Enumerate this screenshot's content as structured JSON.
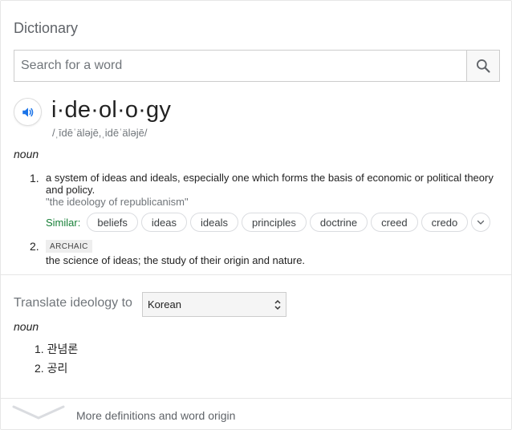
{
  "panel": {
    "title": "Dictionary"
  },
  "search": {
    "placeholder": "Search for a word",
    "value": "",
    "button_icon": "search-icon"
  },
  "entry": {
    "audio_icon": "speaker-icon",
    "headword": "i·de·ol·o·gy",
    "phonetic": "/ˌīdēˈäləjē,ˌidēˈäləjē/",
    "part_of_speech": "noun",
    "senses": [
      {
        "number": "1.",
        "definition": "a system of ideas and ideals, especially one which forms the basis of economic or political theory and policy.",
        "example": "\"the ideology of republicanism\"",
        "similar_label": "Similar:",
        "similar": [
          "beliefs",
          "ideas",
          "ideals",
          "principles",
          "doctrine",
          "creed",
          "credo"
        ],
        "more_icon": "chevron-down-icon"
      },
      {
        "number": "2.",
        "register": "ARCHAIC",
        "definition": "the science of ideas; the study of their origin and nature."
      }
    ]
  },
  "translate": {
    "label": "Translate ideology to",
    "language": "Korean",
    "part_of_speech": "noun",
    "items": [
      {
        "number": "1.",
        "text": "관념론"
      },
      {
        "number": "2.",
        "text": "공리"
      }
    ]
  },
  "footer": {
    "more_label": "More definitions and word origin",
    "expand_icon": "chevron-down-icon"
  },
  "colors": {
    "accent": "#1a73e8",
    "similar_label": "#188038",
    "muted": "#70757a"
  }
}
